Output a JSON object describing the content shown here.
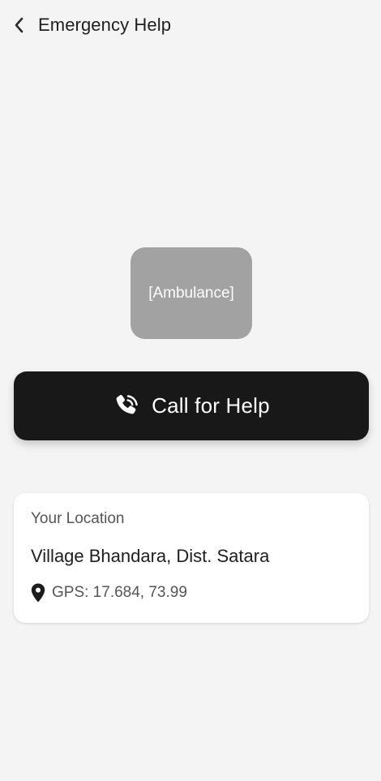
{
  "header": {
    "title": "Emergency Help",
    "back_icon": "chevron-left-icon"
  },
  "illustration": {
    "placeholder": "[Ambulance]"
  },
  "call_button": {
    "label": "Call for Help",
    "icon": "phone-ringing-icon"
  },
  "location": {
    "label": "Your Location",
    "address": "Village Bhandara, Dist. Satara",
    "gps": "GPS: 17.684, 73.99",
    "pin_icon": "map-pin-icon"
  }
}
